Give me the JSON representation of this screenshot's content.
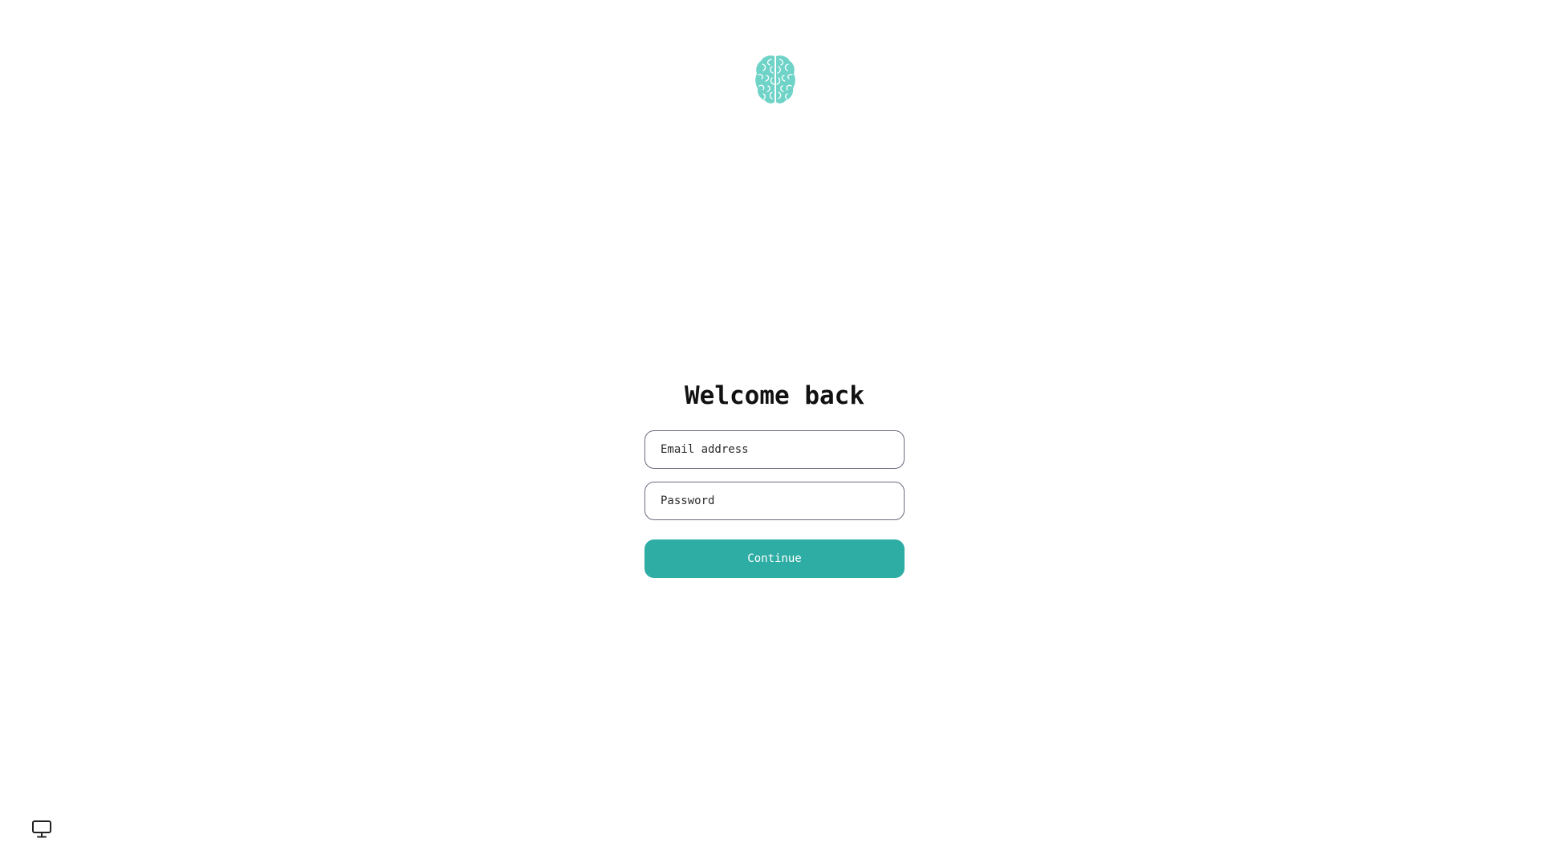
{
  "brand": {
    "logo_icon": "brain-icon",
    "logo_color": "#6fd3c8"
  },
  "login": {
    "title": "Welcome back",
    "email_placeholder": "Email address",
    "email_value": "",
    "password_placeholder": "Password",
    "password_value": "",
    "continue_label": "Continue",
    "accent_color": "#2eada4"
  },
  "footer": {
    "display_icon": "monitor-icon"
  }
}
